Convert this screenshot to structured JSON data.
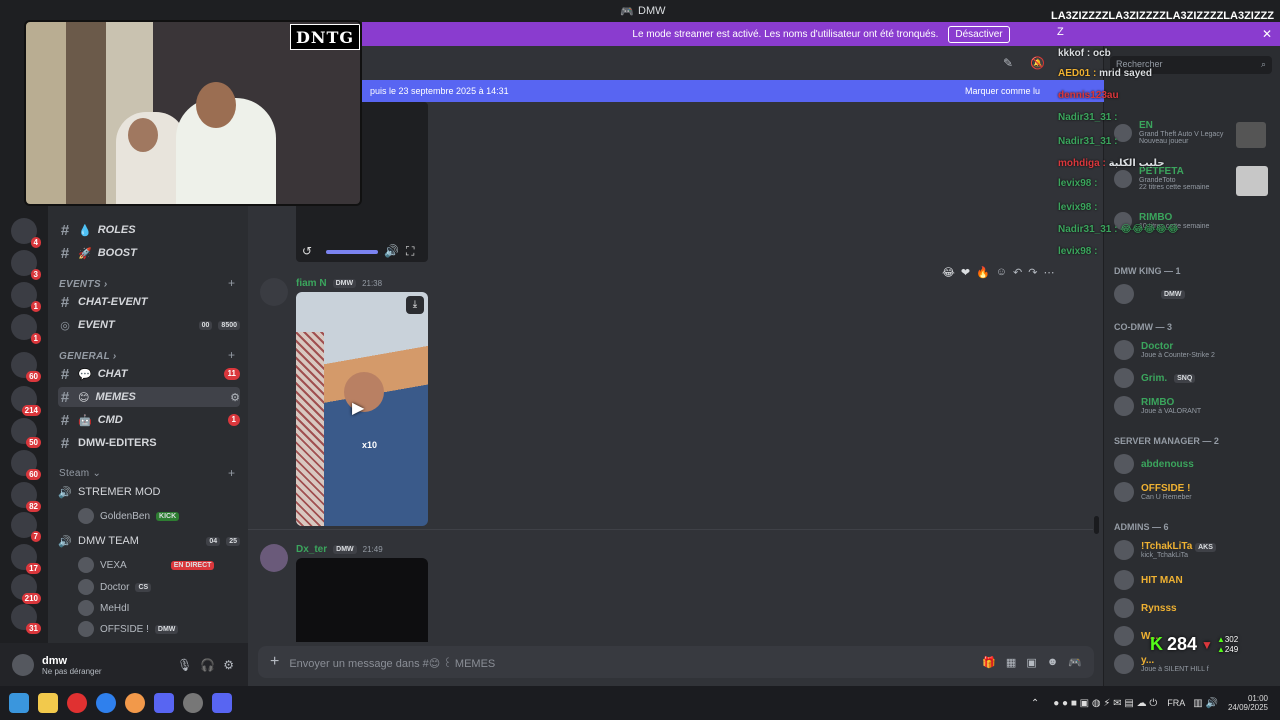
{
  "titlebar": {
    "app": "DMW",
    "marquee": "LA3ZIZZZZLA3ZIZZZZLA3ZIZZZZLA3ZIZZZ"
  },
  "banner": {
    "text": "Le mode streamer est activé. Les noms d'utilisateur ont été tronqués.",
    "button": "Désactiver",
    "z": "Z"
  },
  "overlay": {
    "logo": "DNTG"
  },
  "channels": {
    "items": [
      {
        "name": "ROLES",
        "prefix": "꒰ ROLES"
      },
      {
        "name": "BOOST"
      }
    ],
    "roles": "ROLES",
    "boost": "BOOST",
    "events_cat": "EVENTS",
    "chat_event": "CHAT-EVENT",
    "event": "EVENT",
    "event_tag1": "00",
    "event_tag2": "8500",
    "general_cat": "GENERAL",
    "chat": "CHAT",
    "chat_badge": "11",
    "memes": "MEMES",
    "cmd": "CMD",
    "cmd_badge": "1",
    "editers": "DMW-EDITERS",
    "steam_cat": "Steam",
    "stremer_mod": "STREMER MOD",
    "goldenben": "GoldenBen",
    "kick": "KICK",
    "dmw_team": "DMW TEAM",
    "team_count1": "04",
    "team_count2": "25",
    "vexa": "VEXA",
    "en_direct": "EN DIRECT",
    "doctor": "Doctor",
    "cs": "CS",
    "mehdi": "MeHdI",
    "offside": "OFFSIDE !",
    "dmw_tag": "DMW"
  },
  "servers": {
    "badges": [
      "4",
      "3",
      "1",
      "1",
      "60",
      "214",
      "50",
      "60",
      "82",
      "7",
      "17",
      "210",
      "31"
    ]
  },
  "user": {
    "name": "dmw",
    "status": "Ne pas déranger"
  },
  "notice": {
    "text": "puis le 23 septembre 2025 à 14:31",
    "mark": "Marquer comme lu"
  },
  "messages": [
    {
      "author": "fiam N",
      "tag": "DMW",
      "time": "21:38",
      "media_stat": "x10"
    },
    {
      "author": "Dx_ter",
      "tag": "DMW",
      "time": "21:49"
    }
  ],
  "composer": {
    "placeholder": "Envoyer un message dans #😊 ꒰ MEMES"
  },
  "chat_overlay": [
    {
      "user": "kkkof",
      "msg": "ocb"
    },
    {
      "user": "AED01",
      "msg": "mrid sayed"
    },
    {
      "user": "dennis123au",
      "msg": ""
    },
    {
      "user": "Nadir31_31",
      "msg": ""
    },
    {
      "user": "Nadir31_31",
      "msg": ""
    },
    {
      "user": "mohdiga",
      "msg": "حليب الكلبة"
    },
    {
      "user": "levix98",
      "msg": ""
    },
    {
      "user": "levix98",
      "msg": ""
    },
    {
      "user": "Nadir31_31",
      "msg": "😂😂😂😂😂"
    },
    {
      "user": "levix98",
      "msg": ""
    }
  ],
  "members": {
    "search": "Rechercher",
    "activity": [
      {
        "name": "EN",
        "sub": "Grand Theft Auto V Legacy",
        "sub2": "Nouveau joueur"
      },
      {
        "name": "PETFETA",
        "sub": "GrandeToto",
        "sub2": "22 titres cette semaine"
      },
      {
        "name": "RIMBO",
        "sub": "10 titres cette semaine"
      }
    ],
    "dmw_king": "DMW KING — 1",
    "king_tag": "DMW",
    "co_dmw": "CO-DMW — 3",
    "doctor": "Doctor",
    "doctor_sub": "Joue à Counter-Strike 2",
    "grim": "Grim.",
    "grim_tag": "SNQ",
    "rimbo": "RIMBO",
    "rimbo_sub": "Joue à VALORANT",
    "server_manager": "SERVER MANAGER — 2",
    "abdenouss": "abdenouss",
    "offside": "OFFSIDE !",
    "offside_sub": "Can U Remeber",
    "admins": "ADMINS — 6",
    "tchak": "!TchakLiTa",
    "tchak_tag": "AKS",
    "tchak_sub": "kick_TchakLiTa",
    "hitman": "HIT MAN",
    "rynsss": "Rynsss",
    "w": "W...",
    "y": "y...",
    "y_sub": "Joue à SILENT HILL f"
  },
  "kick_counter": {
    "value": "284",
    "up": "302",
    "down": "249"
  },
  "taskbar": {
    "lang": "FRA",
    "time": "01:00",
    "date": "24/09/2025"
  },
  "colors": {
    "accent": "#5865f2",
    "banner": "#8a3ccf",
    "green": "#23a55a",
    "red": "#da373c"
  }
}
